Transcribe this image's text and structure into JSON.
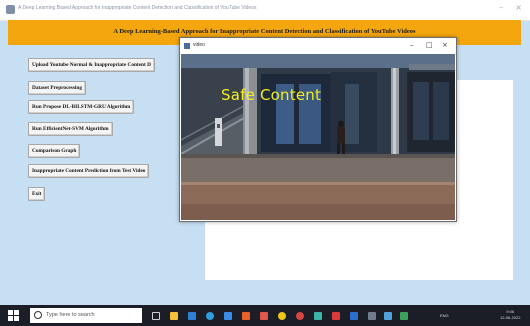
{
  "window": {
    "title": "A Deep Learning Based Approach for Inappropriate Content Detection and Classification of YouTube Videos",
    "minimize": "–",
    "close": "×"
  },
  "header": {
    "title": "A Deep Learning-Based Approach for Inappropriate Content Detection and Classification of YouTube Videos",
    "background": "#f4a60e"
  },
  "buttons": [
    "Upload Youtube Normal & Inappropriate Content D",
    "Dataset Preprocessing",
    "Run Propose DL-BILSTM-GRU Algorithm",
    "Run EfficientNet-SVM Algorithm",
    "Comparison Graph",
    "Inappropriate Content Prediction from Test Video",
    "Exit"
  ],
  "video_window": {
    "title": "video",
    "minimize": "–",
    "maximize": "□",
    "close": "×",
    "overlay_text": "Safe Content",
    "overlay_color": "#f5ee1b"
  },
  "taskbar": {
    "search_placeholder": "Type here to search",
    "icons": [
      "task-view-icon",
      "file-explorer-icon",
      "mail-icon",
      "edge-icon",
      "store-icon",
      "office-icon",
      "media-icon",
      "chrome-icon",
      "photos-icon",
      "paint-icon",
      "terminal-icon",
      "vs-icon",
      "app-icon",
      "app2-icon",
      "app3-icon"
    ],
    "tray_left": "ENG",
    "clock": [
      "9:06",
      "12-06-2022"
    ]
  }
}
